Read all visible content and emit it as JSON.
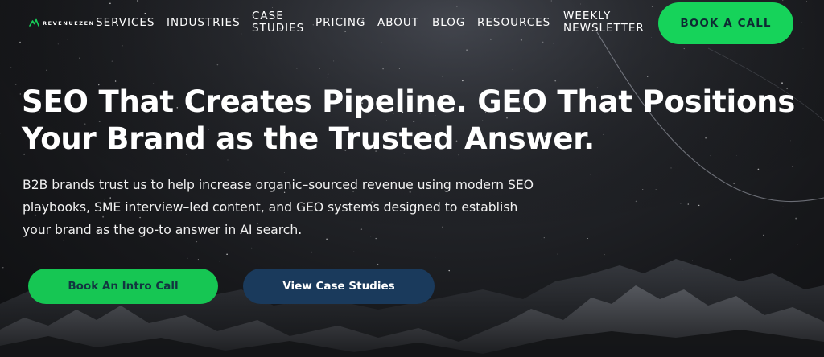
{
  "brand": {
    "name": "REVENUEZEN",
    "accent_color": "#16d35a",
    "secondary_color": "#1a3a5c"
  },
  "nav": {
    "items": [
      {
        "label": "SERVICES"
      },
      {
        "label": "INDUSTRIES"
      },
      {
        "label": "CASE STUDIES"
      },
      {
        "label": "PRICING"
      },
      {
        "label": "ABOUT"
      },
      {
        "label": "BLOG"
      },
      {
        "label": "RESOURCES"
      },
      {
        "label": "WEEKLY NEWSLETTER"
      }
    ],
    "cta_label": "BOOK A CALL"
  },
  "hero": {
    "headline": "SEO That Creates Pipeline. GEO That Positions Your Brand as the Trusted Answer.",
    "subtext": "B2B brands trust us to help increase organic–sourced revenue using modern SEO playbooks, SME interview–led content, and GEO systems designed to establish your brand as the go-to answer in AI search.",
    "primary_button": "Book An Intro Call",
    "secondary_button": "View Case Studies"
  }
}
